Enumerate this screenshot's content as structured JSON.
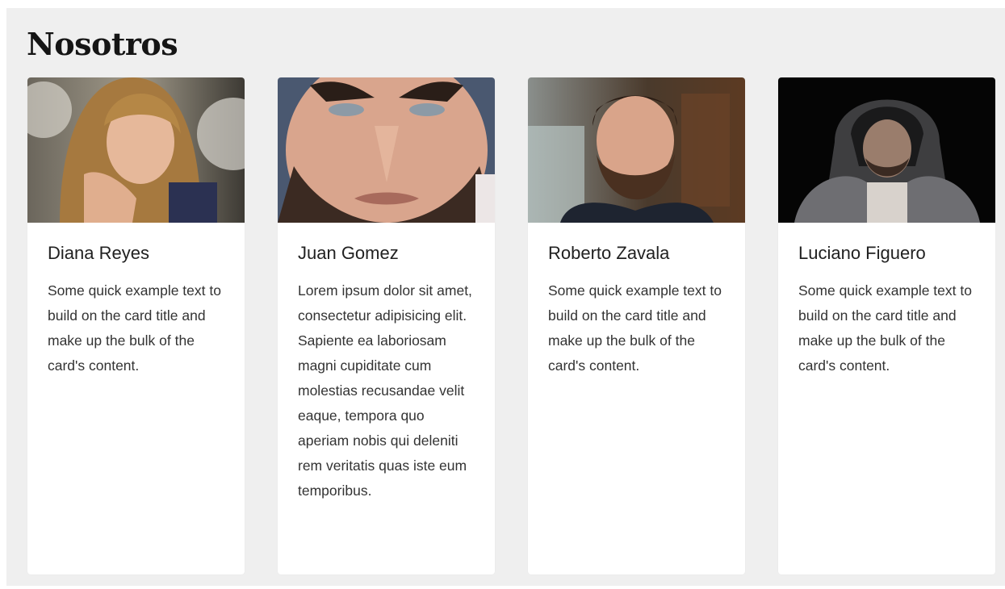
{
  "section": {
    "title": "Nosotros"
  },
  "cards": [
    {
      "name": "Diana Reyes",
      "text": "Some quick example text to build on the card title and make up the bulk of the card's content.",
      "photo": "woman-portrait-photo"
    },
    {
      "name": "Juan Gomez",
      "text": "Lorem ipsum dolor sit amet, consectetur adipisicing elit. Sapiente ea laboriosam magni cupiditate cum molestias recusandae velit eaque, tempora quo aperiam nobis qui deleniti rem veritatis quas iste eum temporibus.",
      "photo": "bearded-man-closeup-photo"
    },
    {
      "name": "Roberto Zavala",
      "text": "Some quick example text to build on the card title and make up the bulk of the card's content.",
      "photo": "bearded-man-portrait-photo"
    },
    {
      "name": "Luciano Figuero",
      "text": "Some quick example text to build on the card title and make up the bulk of the card's content.",
      "photo": "hooded-man-photo"
    }
  ],
  "colors": {
    "section_bg": "#efefef",
    "card_bg": "#ffffff",
    "heading": "#151515",
    "body_text": "#333333"
  }
}
